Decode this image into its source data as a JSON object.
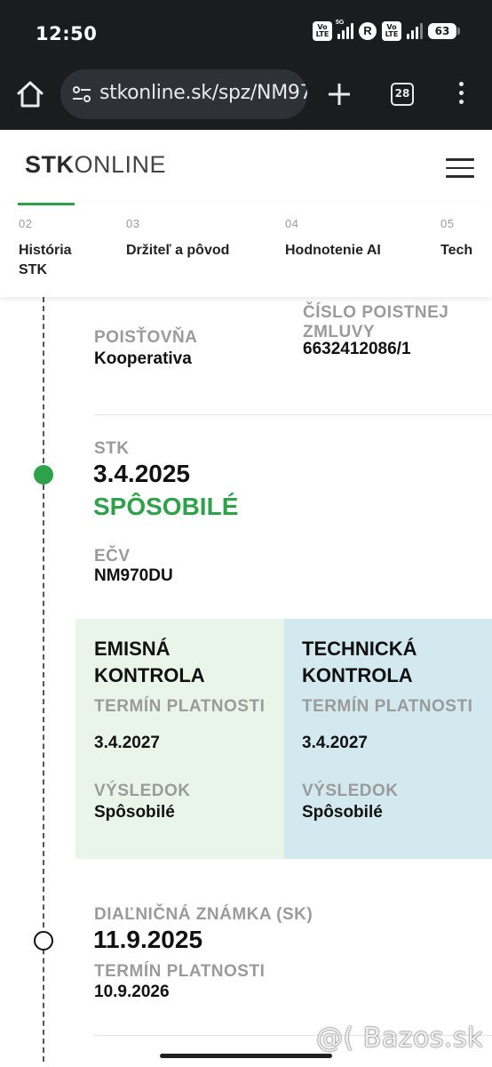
{
  "status_bar": {
    "time": "12:50",
    "volte1": "Vo LTE",
    "net": "5G",
    "r_badge": "R",
    "volte2": "Vo LTE",
    "battery": "63"
  },
  "browser": {
    "url": "stkonline.sk/spz/NM97",
    "tab_count": "28",
    "icons": [
      "home-icon",
      "site-settings-icon",
      "plus-icon",
      "tabs-icon",
      "more-icon"
    ]
  },
  "site": {
    "logo_bold": "STK",
    "logo_light": "ONLINE"
  },
  "tabs": [
    {
      "num": "02",
      "label": "História STK"
    },
    {
      "num": "03",
      "label": "Držiteľ a pôvod"
    },
    {
      "num": "04",
      "label": "Hodnotenie AI"
    },
    {
      "num": "05",
      "label": "Tech"
    }
  ],
  "insurance": {
    "insurer_label": "POISŤOVŇA",
    "insurer_value": "Kooperativa",
    "policy_label": "ČÍSLO POISTNEJ ZMLUVY",
    "policy_value": "6632412086/1"
  },
  "stk": {
    "label": "STK",
    "date": "3.4.2025",
    "status": "SPÔSOBILÉ",
    "ecv_label": "EČV",
    "ecv_value": "NM970DU"
  },
  "emission": {
    "title": "EMISNÁ KONTROLA",
    "validity_label": "TERMÍN PLATNOSTI",
    "validity_value": "3.4.2027",
    "result_label": "VÝSLEDOK",
    "result_value": "Spôsobilé"
  },
  "technical": {
    "title": "TECHNICKÁ KONTROLA",
    "validity_label": "TERMÍN PLATNOSTI",
    "validity_value": "3.4.2027",
    "result_label": "VÝSLEDOK",
    "result_value": "Spôsobilé"
  },
  "vignette": {
    "label": "DIAĽNIČNÁ ZNÁMKA (SK)",
    "date": "11.9.2025",
    "validity_label": "TERMÍN PLATNOSTI",
    "validity_value": "10.9.2026"
  },
  "colors": {
    "accent_green": "#2ea24a",
    "emission_bg": "#eaf5ea",
    "technical_bg": "#d2e9ef"
  },
  "watermark": "@( Bazos.sk"
}
